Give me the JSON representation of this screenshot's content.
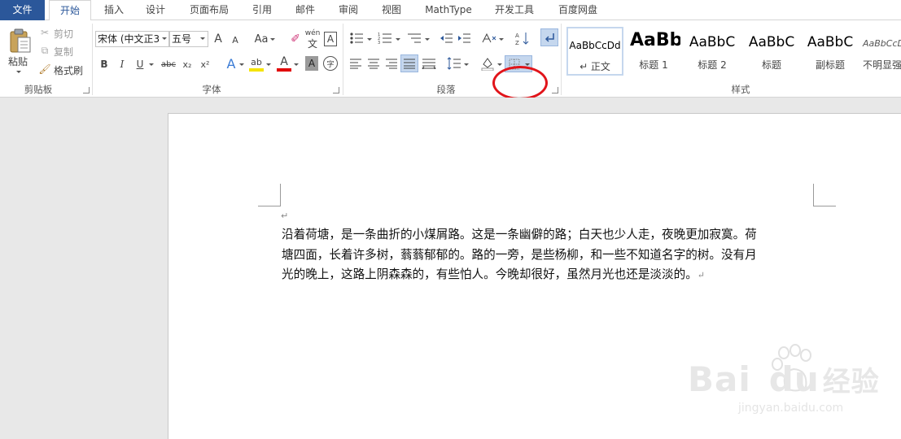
{
  "tabs": [
    {
      "label": "文件"
    },
    {
      "label": "开始"
    },
    {
      "label": "插入"
    },
    {
      "label": "设计"
    },
    {
      "label": "页面布局"
    },
    {
      "label": "引用"
    },
    {
      "label": "邮件"
    },
    {
      "label": "审阅"
    },
    {
      "label": "视图"
    },
    {
      "label": "MathType"
    },
    {
      "label": "开发工具"
    },
    {
      "label": "百度网盘"
    }
  ],
  "clipboard": {
    "paste": "粘贴",
    "cut": "剪切",
    "copy": "复制",
    "format_painter": "格式刷",
    "group_label": "剪贴板"
  },
  "font": {
    "name": "宋体 (中文正3",
    "size": "五号",
    "grow": "A",
    "shrink": "A",
    "case": "Aa",
    "bold": "B",
    "italic": "I",
    "underline": "U",
    "strike": "abc",
    "subscript": "x₂",
    "superscript": "x²",
    "phonetic": "wén",
    "phonetic_char": "文",
    "border_char": "A",
    "effects": "A",
    "highlight": "ab",
    "color": "A",
    "shading": "A",
    "enclose": "字",
    "group_label": "字体"
  },
  "paragraph": {
    "group_label": "段落"
  },
  "styles": {
    "group_label": "样式",
    "items": [
      {
        "preview": "AaBbCcDd",
        "name": "↵ 正文"
      },
      {
        "preview": "AaBb",
        "name": "标题 1"
      },
      {
        "preview": "AaBbC",
        "name": "标题 2"
      },
      {
        "preview": "AaBbC",
        "name": "标题"
      },
      {
        "preview": "AaBbC",
        "name": "副标题"
      },
      {
        "preview": "AaBbCcD",
        "name": "不明显强"
      }
    ]
  },
  "document": {
    "empty_para_mark": "↵",
    "lines": [
      "沿着荷塘，是一条曲折的小煤屑路。这是一条幽僻的路；白天也少人走，夜晚更加寂寞。荷",
      "塘四面，长着许多树，蓊蓊郁郁的。路的一旁，是些杨柳，和一些不知道名字的树。没有月",
      "光的晚上，这路上阴森森的，有些怕人。今晚却很好，虽然月光也还是淡淡的。"
    ],
    "end_mark": "↵"
  },
  "watermark": {
    "brand": "Bai",
    "brand2": "du",
    "cn": "经验",
    "url": "jingyan.baidu.com"
  },
  "colors": {
    "accent": "#2b579a",
    "highlight_ring": "#e1141a"
  }
}
